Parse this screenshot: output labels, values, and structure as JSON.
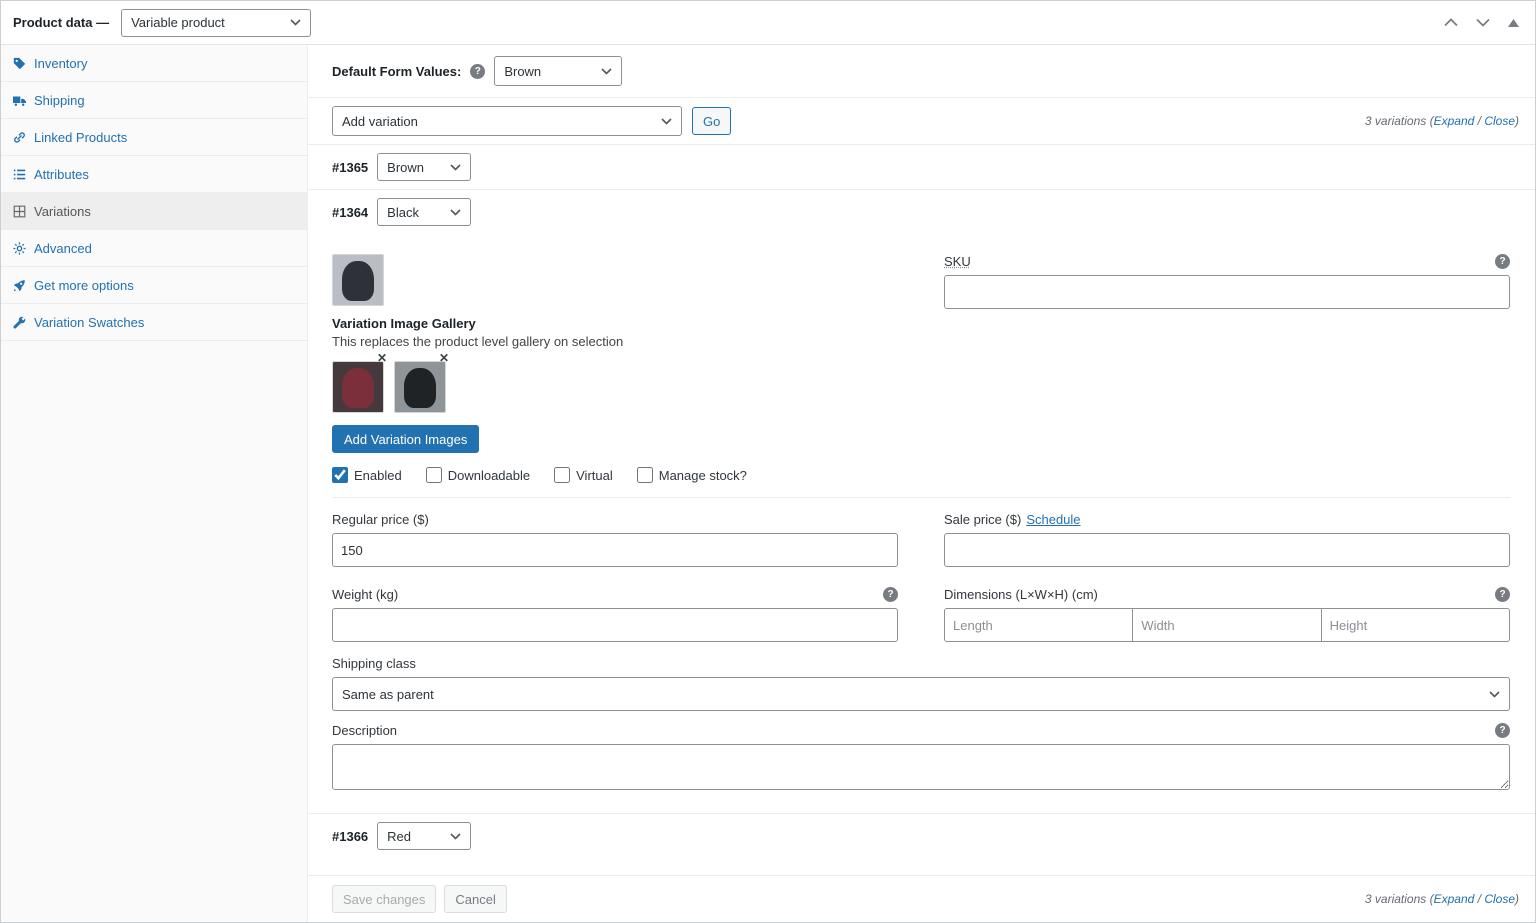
{
  "colors": {
    "accent": "#2271b1",
    "primary_button": "#2271b1",
    "sidebar_bg": "#fafafa"
  },
  "icons": {
    "help": "?",
    "remove": "✕"
  },
  "header": {
    "title": "Product data —",
    "product_type": "Variable product"
  },
  "sidebar": {
    "items": [
      {
        "label": "Inventory",
        "active": false
      },
      {
        "label": "Shipping",
        "active": false
      },
      {
        "label": "Linked Products",
        "active": false
      },
      {
        "label": "Attributes",
        "active": false
      },
      {
        "label": "Variations",
        "active": true
      },
      {
        "label": "Advanced",
        "active": false
      },
      {
        "label": "Get more options",
        "active": false
      },
      {
        "label": "Variation Swatches",
        "active": false
      }
    ]
  },
  "main": {
    "default_form": {
      "label": "Default Form Values:",
      "value": "Brown"
    },
    "toolbar": {
      "add_variation": "Add variation",
      "go": "Go"
    },
    "variations_links": {
      "prefix": "3 variations (",
      "expand": "Expand",
      "sep": " / ",
      "close": "Close",
      "suffix": ")"
    },
    "rows": [
      {
        "id": "#1365",
        "value": "Brown"
      },
      {
        "id": "#1364",
        "value": "Black"
      },
      {
        "id": "#1366",
        "value": "Red"
      }
    ],
    "detail": {
      "sku_label": "SKU",
      "gallery_title": "Variation Image Gallery",
      "gallery_note": "This replaces the product level gallery on selection",
      "add_images": "Add Variation Images",
      "checkboxes": [
        {
          "label": "Enabled",
          "checked": true
        },
        {
          "label": "Downloadable",
          "checked": false
        },
        {
          "label": "Virtual",
          "checked": false
        },
        {
          "label": "Manage stock?",
          "checked": false
        }
      ],
      "regular_price_label": "Regular price ($)",
      "regular_price_value": "150",
      "sale_price_label": "Sale price ($)",
      "schedule": "Schedule",
      "weight_label": "Weight (kg)",
      "dimensions_label": "Dimensions (L×W×H) (cm)",
      "length_placeholder": "Length",
      "width_placeholder": "Width",
      "height_placeholder": "Height",
      "shipping_class_label": "Shipping class",
      "shipping_class_value": "Same as parent",
      "description_label": "Description"
    },
    "footer": {
      "save": "Save changes",
      "cancel": "Cancel"
    }
  }
}
